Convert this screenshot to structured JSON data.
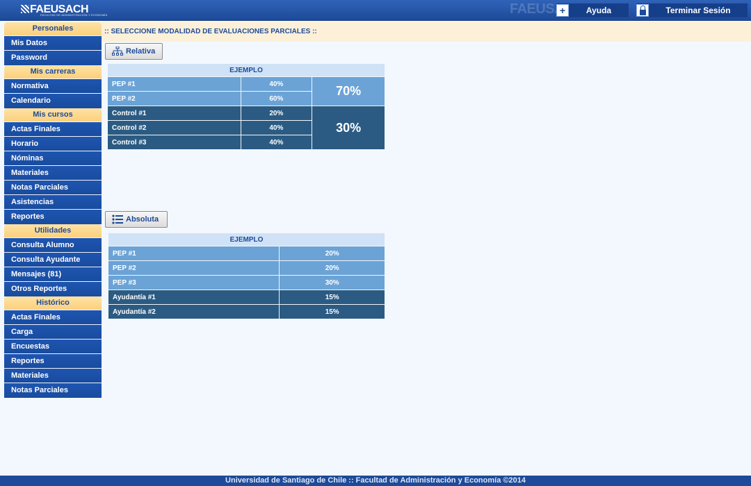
{
  "header": {
    "logo_text": "FAEUSACH",
    "logo_subtitle": "FACULTAD DE ADMINISTRACIÓN Y ECONOMÍA",
    "help_label": "Ayuda",
    "logout_label": "Terminar Sesión"
  },
  "sidebar": {
    "personales": {
      "title": "Personales",
      "items": [
        "Mis Datos",
        "Password"
      ]
    },
    "carreras": {
      "title": "Mis carreras",
      "items": [
        "Normativa",
        "Calendario"
      ]
    },
    "cursos": {
      "title": "Mis cursos",
      "items": [
        "Actas Finales",
        "Horario",
        "Nóminas",
        "Materiales",
        "Notas Parciales",
        "Asistencias",
        "Reportes"
      ]
    },
    "utilidades": {
      "title": "Utilidades",
      "items": [
        "Consulta Alumno",
        "Consulta Ayudante",
        "Mensajes (81)",
        "Otros Reportes"
      ]
    },
    "historico": {
      "title": "Histórico",
      "items": [
        "Actas Finales",
        "Carga",
        "Encuestas",
        "Reportes",
        "Materiales",
        "Notas Parciales"
      ]
    }
  },
  "main": {
    "heading": ":: SELECCIONE MODALIDAD DE EVALUACIONES PARCIALES ::",
    "relativa": {
      "button_label": "Relativa",
      "table_header": "EJEMPLO",
      "rows": [
        {
          "name": "PEP #1",
          "value": "40%"
        },
        {
          "name": "PEP #2",
          "value": "60%"
        },
        {
          "name": "Control #1",
          "value": "20%"
        },
        {
          "name": "Control #2",
          "value": "40%"
        },
        {
          "name": "Control #3",
          "value": "40%"
        }
      ],
      "group_pep": "70%",
      "group_control": "30%"
    },
    "absoluta": {
      "button_label": "Absoluta",
      "table_header": "EJEMPLO",
      "rows": [
        {
          "name": "PEP #1",
          "value": "20%"
        },
        {
          "name": "PEP #2",
          "value": "20%"
        },
        {
          "name": "PEP #3",
          "value": "30%"
        },
        {
          "name": "Ayudantía #1",
          "value": "15%"
        },
        {
          "name": "Ayudantía #2",
          "value": "15%"
        }
      ]
    }
  },
  "footer": {
    "text": "Universidad de Santiago de Chile :: Facultad de Administración y Economía ©2014"
  },
  "colors": {
    "header_blue": "#1d4a99",
    "section_yellow": "#fbd07d",
    "light_row": "#6ba3d6",
    "dark_row": "#2b5b83"
  }
}
